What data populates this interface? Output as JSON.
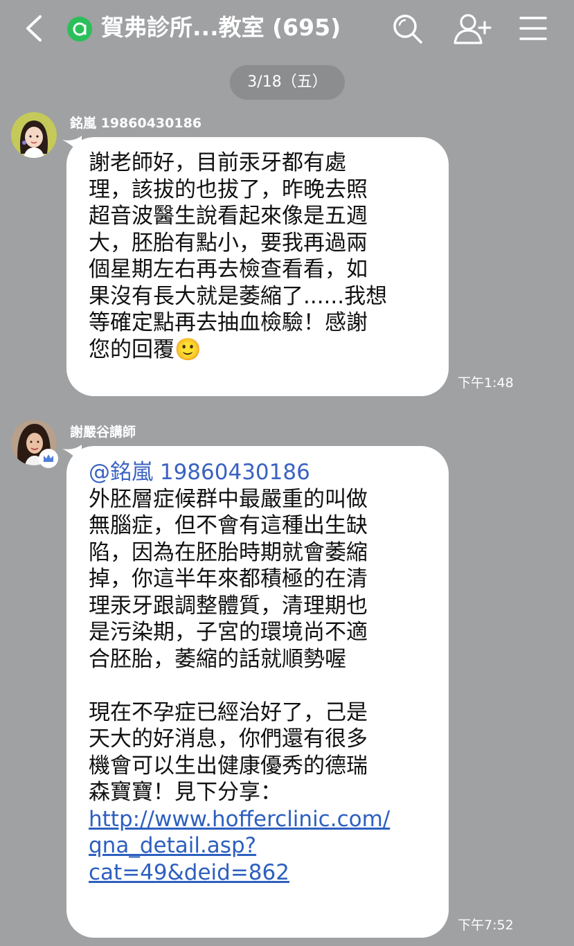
{
  "header": {
    "title": "賀弗診所...教室 (695)",
    "icons": [
      "back-icon",
      "group-badge-icon",
      "search-icon",
      "add-friend-icon",
      "menu-icon"
    ]
  },
  "date_divider": "3/18（五）",
  "messages": [
    {
      "sender": "銘嵐 19860430186",
      "lines": [
        "謝老師好，目前汞牙都有處",
        "理，該拔的也拔了，昨晚去照",
        "超音波醫生說看起來像是五週",
        "大，胚胎有點小，要我再過兩",
        "個星期左右再去檢查看看，如",
        "果沒有長大就是萎縮了......我想",
        "等確定點再去抽血檢驗！感謝",
        "您的回覆"
      ],
      "emoji": "🙂",
      "time": "下午1:48"
    },
    {
      "sender": "謝嚴谷講師",
      "mention": "@銘嵐 19860430186",
      "lines_a": [
        "外胚層症候群中最嚴重的叫做",
        "無腦症，但不會有這種出生缺",
        "陷，因為在胚胎時期就會萎縮",
        "掉，你這半年來都積極的在清",
        "理汞牙跟調整體質，清理期也",
        "是污染期，子宮的環境尚不適",
        "合胚胎，萎縮的話就順勢喔"
      ],
      "lines_b": [
        "現在不孕症已經治好了，己是",
        "天大的好消息，你們還有很多",
        "機會可以生出健康優秀的德瑞",
        "森寶寶！見下分享："
      ],
      "link_lines": [
        "http://www.hofferclinic.com/",
        "qna_detail.asp?",
        "cat=49&deid=862"
      ],
      "time": "下午7:52"
    }
  ],
  "colors": {
    "background": "#9fa1a3",
    "bubble": "#ffffff",
    "link": "#2d5fbf",
    "group_badge": "#2bbf5a"
  }
}
